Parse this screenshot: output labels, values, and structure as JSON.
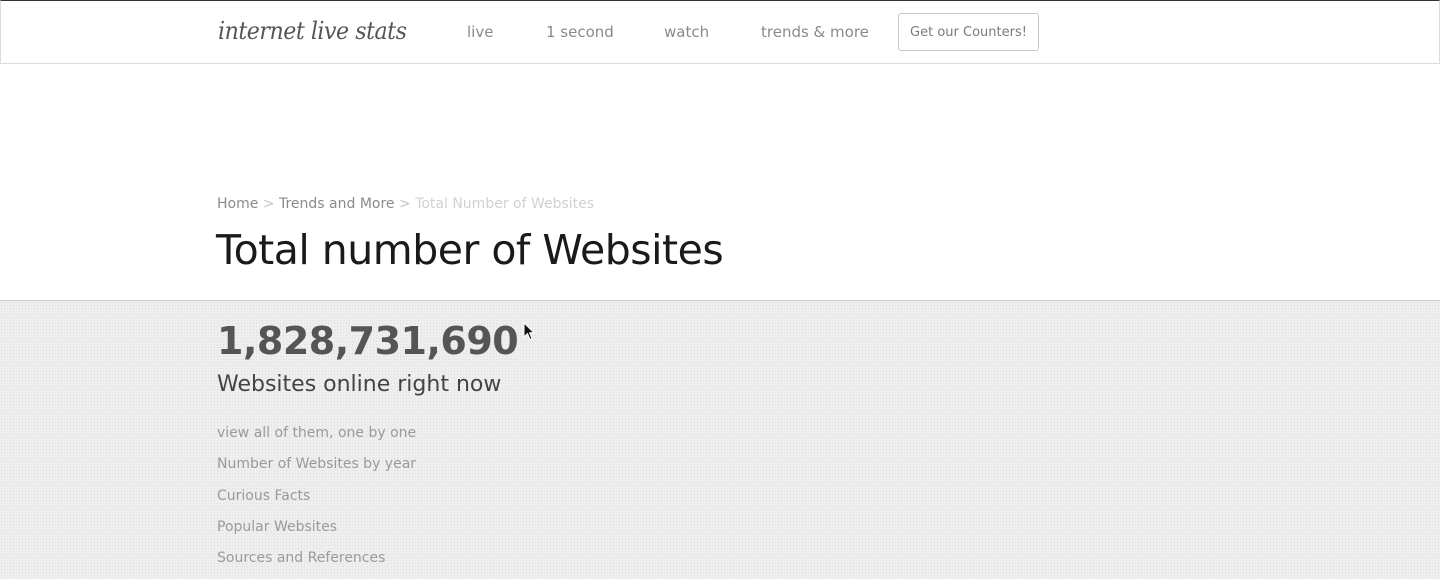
{
  "header": {
    "logo_text": "internet live stats",
    "nav": [
      {
        "label": "live"
      },
      {
        "label": "1 second"
      },
      {
        "label": "watch"
      },
      {
        "label": "trends & more"
      }
    ],
    "cta_label": "Get our Counters!"
  },
  "breadcrumb": {
    "items": [
      "Home",
      "Trends and More",
      "Total Number of Websites"
    ],
    "separator": ">"
  },
  "page": {
    "title": "Total number of Websites"
  },
  "stats": {
    "counter_value": "1,828,731,690",
    "counter_label": "Websites online right now",
    "links": [
      "view all of them, one by one",
      "Number of Websites by year",
      "Curious Facts",
      "Popular Websites",
      "Sources and References"
    ]
  },
  "icons": {
    "cursor": "mouse-pointer-icon"
  }
}
